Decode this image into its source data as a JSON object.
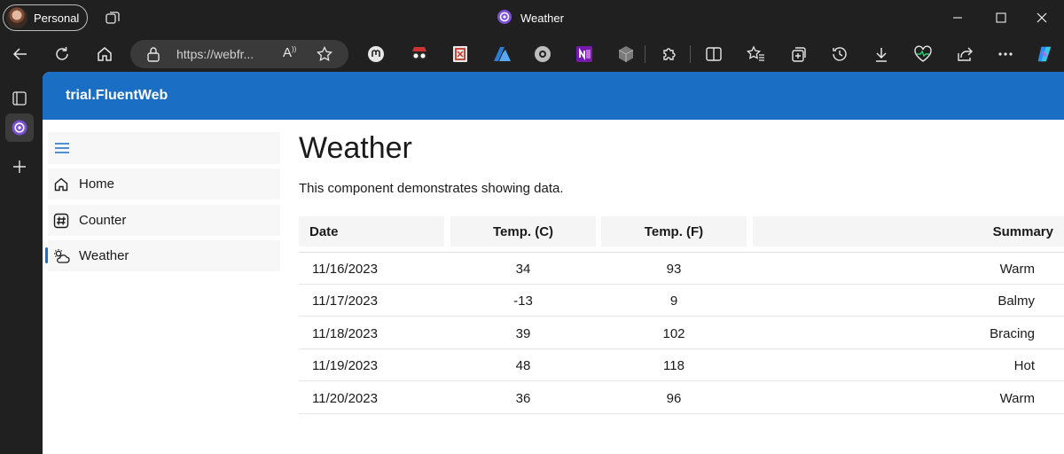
{
  "browser": {
    "profile_label": "Personal",
    "window_title": "Weather",
    "url_text": "https://webfr...",
    "read_aloud_glyph": "A"
  },
  "app": {
    "header_title": "trial.FluentWeb",
    "accent_color": "#1a6fc4"
  },
  "nav": {
    "items": [
      {
        "label": "Home",
        "icon": "home-icon"
      },
      {
        "label": "Counter",
        "icon": "hash-icon"
      },
      {
        "label": "Weather",
        "icon": "weather-icon",
        "active": true
      }
    ]
  },
  "page": {
    "title": "Weather",
    "description": "This component demonstrates showing data."
  },
  "table": {
    "headers": [
      "Date",
      "Temp. (C)",
      "Temp. (F)",
      "Summary"
    ],
    "rows": [
      [
        "11/16/2023",
        "34",
        "93",
        "Warm"
      ],
      [
        "11/17/2023",
        "-13",
        "9",
        "Balmy"
      ],
      [
        "11/18/2023",
        "39",
        "102",
        "Bracing"
      ],
      [
        "11/19/2023",
        "48",
        "118",
        "Hot"
      ],
      [
        "11/20/2023",
        "36",
        "96",
        "Warm"
      ]
    ]
  }
}
